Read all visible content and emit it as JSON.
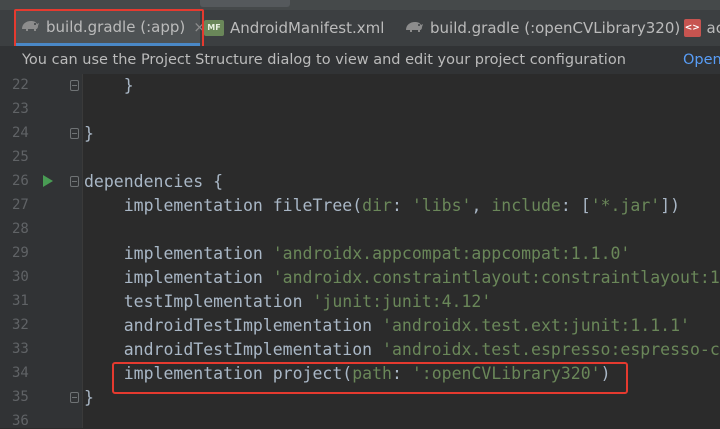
{
  "tabs": [
    {
      "label": "build.gradle (:app)",
      "icon": "gradle-icon",
      "active": true,
      "closable": true
    },
    {
      "label": "AndroidManifest.xml",
      "icon": "manifest-icon",
      "active": false
    },
    {
      "label": "build.gradle (:openCVLibrary320)",
      "icon": "gradle-icon",
      "active": false
    },
    {
      "label": "ac",
      "icon": "xml-icon",
      "active": false
    }
  ],
  "tab_close_glyph": "×",
  "manifest_icon_text": "MF",
  "xml_icon_text": "<>",
  "notice": {
    "message": "You can use the Project Structure dialog to view and edit your project configuration",
    "link": "Open"
  },
  "line_numbers": [
    "22",
    "23",
    "24",
    "25",
    "26",
    "27",
    "28",
    "29",
    "30",
    "31",
    "32",
    "33",
    "34",
    "35",
    "36"
  ],
  "code": {
    "l22": "    }",
    "l24": "}",
    "l26": "dependencies {",
    "l27": {
      "pre": "    implementation fileTree(",
      "p1": "dir",
      "sep1": ": ",
      "s1": "'libs'",
      "mid": ", ",
      "p2": "include",
      "sep2": ": [",
      "s2": "'*.jar'",
      "end": "])"
    },
    "l29": {
      "kw": "    implementation ",
      "str": "'androidx.appcompat:appcompat:1.1.0'"
    },
    "l30": {
      "kw": "    implementation ",
      "str": "'androidx.constraintlayout:constraintlayout:1"
    },
    "l31": {
      "kw": "    testImplementation ",
      "str": "'junit:junit:4.12'"
    },
    "l32": {
      "kw": "    androidTestImplementation ",
      "str": "'androidx.test.ext:junit:1.1.1'"
    },
    "l33": {
      "kw": "    androidTestImplementation ",
      "str": "'androidx.test.espresso:espresso-c"
    },
    "l34": {
      "pre": "    implementation project(",
      "p": "path",
      "sep": ": ",
      "str": "':openCVLibrary320'",
      "end": ")"
    },
    "l35": "}"
  },
  "colors": {
    "highlight": "#e53a2f",
    "string": "#6a8759",
    "code_text": "#a9b7c6",
    "link": "#589df6"
  }
}
